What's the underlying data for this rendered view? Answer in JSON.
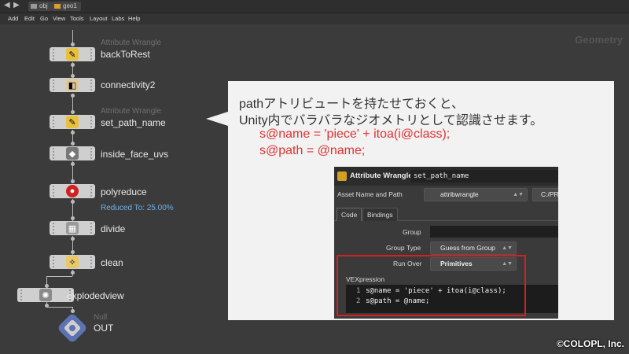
{
  "path_bar": {
    "back_icon": "back-arrow-icon",
    "forward_icon": "forward-arrow-icon",
    "crumbs": [
      "obj",
      "geo1"
    ]
  },
  "menu": [
    "Add",
    "Edit",
    "Go",
    "View",
    "Tools",
    "Layout",
    "Labs",
    "Help"
  ],
  "network": {
    "context_label": "Geometry",
    "nodes": [
      {
        "name": "backToRest",
        "type": "Attribute Wrangle",
        "icon": "wrangle-icon"
      },
      {
        "name": "connectivity2",
        "type": "",
        "icon": "connectivity-icon"
      },
      {
        "name": "set_path_name",
        "type": "Attribute Wrangle",
        "icon": "wrangle-icon"
      },
      {
        "name": "inside_face_uvs",
        "type": "",
        "icon": "uv-icon"
      },
      {
        "name": "polyreduce",
        "type": "",
        "icon": "polyreduce-icon",
        "info": "Reduced To: 25.00%"
      },
      {
        "name": "divide",
        "type": "",
        "icon": "divide-icon"
      },
      {
        "name": "clean",
        "type": "",
        "icon": "clean-icon"
      },
      {
        "name": "explodedview",
        "type": "",
        "icon": "explodedview-icon"
      },
      {
        "name": "OUT",
        "type": "Null",
        "icon": "null-icon"
      }
    ]
  },
  "callout": {
    "line1": "pathアトリビュートを持たせておくと、",
    "line2": "Unity内でバラバラなジオメトリとして認識させます。",
    "code1": "s@name = 'piece' + itoa(i@class);",
    "code2": "s@path = @name;"
  },
  "panel": {
    "type_label": "Attribute Wrangle",
    "node_name": "set_path_name",
    "asset_label": "Asset Name and Path",
    "asset_value": "attribwrangle",
    "asset_path": "C:/PR",
    "tabs": [
      "Code",
      "Bindings"
    ],
    "group_label": "Group",
    "group_value": "",
    "group_type_label": "Group Type",
    "group_type_value": "Guess from Group",
    "run_over_label": "Run Over",
    "run_over_value": "Primitives",
    "vex_label": "VEXpression",
    "vex_lines": [
      {
        "num": "1",
        "text": "s@name = 'piece' + itoa(i@class);"
      },
      {
        "num": "2",
        "text": "s@path = @name;"
      }
    ]
  },
  "colors": {
    "highlight": "#d42020",
    "code_text": "#e03232",
    "info_text": "#6fb0e8"
  },
  "copyright": "©COLOPL, Inc."
}
